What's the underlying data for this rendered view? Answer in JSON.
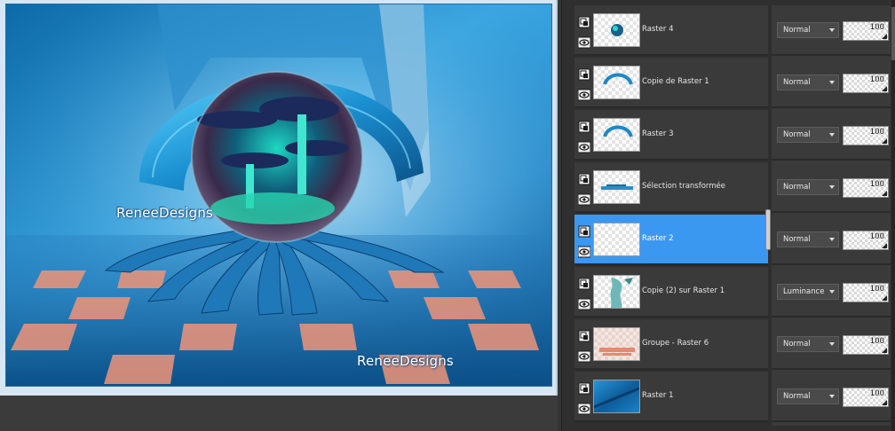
{
  "canvas": {
    "watermarks": [
      "ReneeDesigns",
      "ReneeDesigns"
    ]
  },
  "layers": [
    {
      "name": "Raster 4",
      "blend_mode": "Normal",
      "opacity": "100",
      "selected": false,
      "thumb": "raster-4"
    },
    {
      "name": "Copie de Raster 1",
      "blend_mode": "Normal",
      "opacity": "100",
      "selected": false,
      "thumb": "arc"
    },
    {
      "name": "Raster 3",
      "blend_mode": "Normal",
      "opacity": "100",
      "selected": false,
      "thumb": "arc"
    },
    {
      "name": "Sélection transformée",
      "blend_mode": "Normal",
      "opacity": "100",
      "selected": false,
      "thumb": "strip"
    },
    {
      "name": "Raster 2",
      "blend_mode": "Normal",
      "opacity": "100",
      "selected": true,
      "thumb": "empty"
    },
    {
      "name": "Copie (2) sur Raster 1",
      "blend_mode": "Luminance",
      "opacity": "100",
      "selected": false,
      "thumb": "cyan-splash"
    },
    {
      "name": "Groupe - Raster 6",
      "blend_mode": "Normal",
      "opacity": "100",
      "selected": false,
      "thumb": "peach"
    },
    {
      "name": "Raster 1",
      "blend_mode": "Normal",
      "opacity": "100",
      "selected": false,
      "thumb": "blue"
    }
  ],
  "colors": {
    "selection": "#3b98f0",
    "panel_bg": "#2f2f2f",
    "row_bg": "#3a3a3a"
  },
  "icons": {
    "layer_link": "layer-link-icon",
    "visibility": "eye-icon",
    "dropdown": "chevron-down-icon"
  }
}
